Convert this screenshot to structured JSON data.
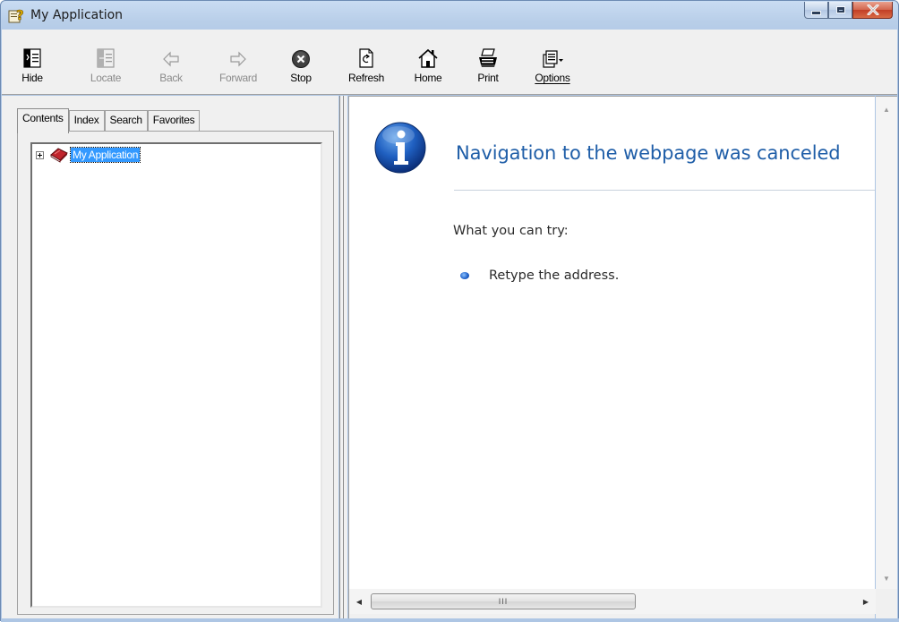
{
  "window": {
    "title": "My Application"
  },
  "toolbar": {
    "buttons": [
      {
        "label": "Hide",
        "icon": "hide-icon",
        "enabled": true
      },
      {
        "label": "Locate",
        "icon": "locate-icon",
        "enabled": false
      },
      {
        "label": "Back",
        "icon": "back-arrow-icon",
        "enabled": false
      },
      {
        "label": "Forward",
        "icon": "forward-arrow-icon",
        "enabled": false
      },
      {
        "label": "Stop",
        "icon": "stop-icon",
        "enabled": true
      },
      {
        "label": "Refresh",
        "icon": "refresh-icon",
        "enabled": true
      },
      {
        "label": "Home",
        "icon": "home-icon",
        "enabled": true
      },
      {
        "label": "Print",
        "icon": "print-icon",
        "enabled": true
      },
      {
        "label": "Options",
        "icon": "options-icon",
        "enabled": true
      }
    ]
  },
  "nav_tabs": [
    {
      "label": "Contents",
      "active": true
    },
    {
      "label": "Index",
      "active": false
    },
    {
      "label": "Search",
      "active": false
    },
    {
      "label": "Favorites",
      "active": false
    }
  ],
  "tree": {
    "items": [
      {
        "label": "My Application",
        "expanded": false,
        "selected": true,
        "icon": "book-icon"
      }
    ]
  },
  "content": {
    "heading": "Navigation to the webpage was canceled",
    "subheading": "What you can try:",
    "suggestions": [
      "Retype the address."
    ]
  },
  "scrollbar": {
    "thumb_glyph": "III"
  },
  "colors": {
    "heading": "#1f5ea8",
    "selection": "#3399ff",
    "frame": "#aec6e4",
    "close_button": "#c94a30"
  }
}
